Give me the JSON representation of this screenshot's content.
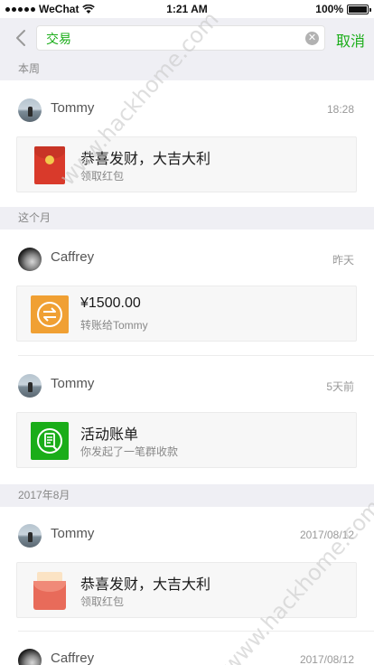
{
  "status_bar": {
    "carrier": "WeChat",
    "time": "1:21 AM",
    "battery": "100%"
  },
  "search": {
    "value": "交易",
    "clear_icon": "clear-icon",
    "cancel_label": "取消"
  },
  "sections": [
    {
      "title": "本周",
      "entries": [
        {
          "name": "Tommy",
          "time": "18:28",
          "avatar": "sea-portrait",
          "card": {
            "icon": "red-packet-icon",
            "title": "恭喜发财，大吉大利",
            "subtitle": "领取红包"
          }
        }
      ]
    },
    {
      "title": "这个月",
      "entries": [
        {
          "name": "Caffrey",
          "time": "昨天",
          "avatar": "dark-portrait",
          "card": {
            "icon": "transfer-icon",
            "title": "¥1500.00",
            "subtitle": "转账给Tommy"
          }
        },
        {
          "name": "Tommy",
          "time": "5天前",
          "avatar": "sea-portrait",
          "card": {
            "icon": "group-bill-icon",
            "title": "活动账单",
            "subtitle": "你发起了一笔群收款"
          }
        }
      ]
    },
    {
      "title": "2017年8月",
      "entries": [
        {
          "name": "Tommy",
          "time": "2017/08/12",
          "avatar": "sea-portrait",
          "card": {
            "icon": "red-packet-opened-icon",
            "title": "恭喜发财，大吉大利",
            "subtitle": "领取红包"
          }
        },
        {
          "name": "Caffrey",
          "time": "2017/08/12",
          "avatar": "dark-portrait"
        }
      ]
    }
  ],
  "watermark": "www.hackhome.com",
  "colors": {
    "accent_green": "#1aad19",
    "red_packet": "#d93a2b",
    "transfer_orange": "#f0a033",
    "section_bg": "#efeff4"
  }
}
